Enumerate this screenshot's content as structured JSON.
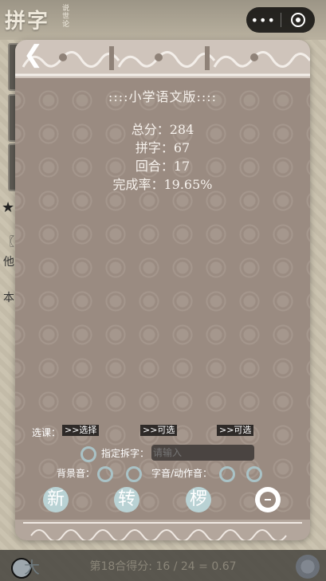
{
  "background": {
    "title": "拼字",
    "subtitle": "说世论",
    "star": "★",
    "text1": "〖",
    "text2": "他",
    "text3": "本",
    "bottom_bar_text": "第18合得分: 16 / 24 = 0.67",
    "bottom_left_char": "大"
  },
  "capsule": {
    "more_label": "•••",
    "close_icon": "target-icon"
  },
  "dialog": {
    "back_label": "❮",
    "title": "::::小学语文版::::",
    "stats": {
      "total": "总分：284",
      "pinzi": "拼字：67",
      "rounds": "回合：17",
      "rate": "完成率：19.65%"
    },
    "lesson": {
      "label": "选课：",
      "pick1": ">>选择",
      "pick2": ">>可选",
      "pick3": ">>可选"
    },
    "specify": {
      "label": "指定拆字：",
      "placeholder": "请输入"
    },
    "sound": {
      "bgm_label": "背景音：",
      "fx_label": "字音/动作音："
    },
    "actions": {
      "new": "新",
      "switch": "转",
      "hint": "椤"
    }
  },
  "colors": {
    "dialog_bg": "#9a8b81",
    "ring": "#a9c2c6",
    "action_btn": "#b9d2d4"
  }
}
